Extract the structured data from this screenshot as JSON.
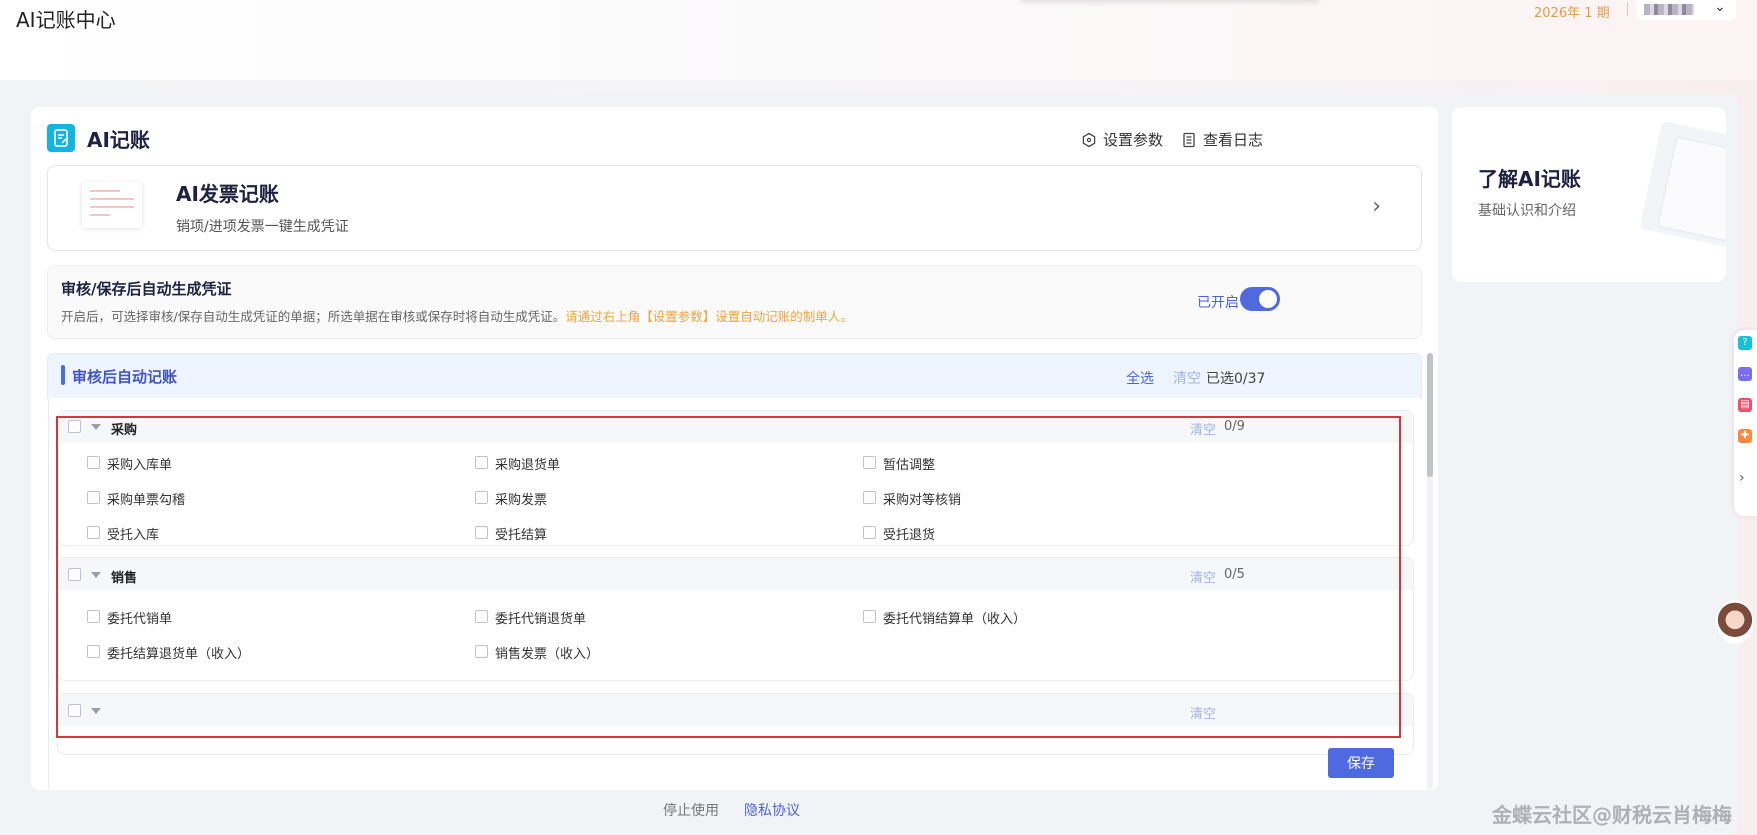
{
  "header": {
    "app_title": "AI记账中心",
    "period": "2026年 1 期"
  },
  "card": {
    "title": "AI记账",
    "settings_label": "设置参数",
    "log_label": "查看日志"
  },
  "invoice": {
    "title": "AI发票记账",
    "subtitle": "销项/进项发票一键生成凭证"
  },
  "auto_voucher": {
    "title": "审核/保存后自动生成凭证",
    "desc": "开启后，可选择审核/保存自动生成凭证的单据；所选单据在审核或保存时将自动生成凭证。",
    "tip": "请通过右上角【设置参数】设置自动记账的制单人。",
    "toggle_label": "已开启",
    "enabled": true
  },
  "section": {
    "title": "审核后自动记账",
    "select_all": "全选",
    "clear": "清空",
    "selected_count": "已选0/37"
  },
  "groups": [
    {
      "name": "采购",
      "clear": "清空",
      "count": "0/9",
      "items": [
        "采购入库单",
        "采购退货单",
        "暂估调整",
        "采购单票勾稽",
        "采购发票",
        "采购对等核销",
        "受托入库",
        "受托结算",
        "受托退货"
      ]
    },
    {
      "name": "销售",
      "clear": "清空",
      "count": "0/5",
      "items": [
        "委托代销单",
        "委托代销退货单",
        "委托代销结算单（收入）",
        "委托结算退货单（收入）",
        "销售发票（收入）"
      ]
    },
    {
      "name": "",
      "clear": "清空",
      "count": "",
      "items": []
    }
  ],
  "footer": {
    "save": "保存",
    "stop": "停止使用",
    "privacy": "隐私协议"
  },
  "side": {
    "title": "了解AI记账",
    "subtitle": "基础认识和介绍"
  },
  "float_bar": {
    "icons": [
      "help-icon",
      "chat-icon",
      "clipboard-icon",
      "gift-icon"
    ],
    "colors": [
      "#18c1d8",
      "#7b6cf0",
      "#f0506e",
      "#ff8a3d"
    ]
  },
  "watermark": "金蝶云社区@财税云肖梅梅",
  "colors": {
    "primary": "#4f69e0",
    "warning_text": "#f0a43c",
    "highlight_outline": "#d9343f"
  }
}
